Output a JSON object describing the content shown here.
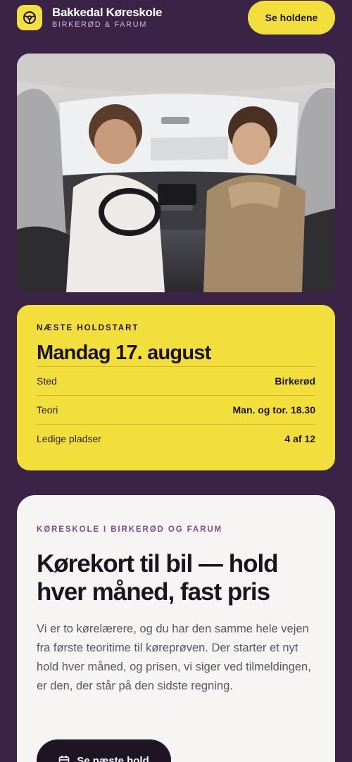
{
  "header": {
    "logo_icon": "steering-wheel-icon",
    "brand_name": "Bakkedal Køreskole",
    "brand_sub": "BIRKERØD & FARUM",
    "cta_label": "Se holdene"
  },
  "hero": {
    "image": "photo of driving instructor and student in car interior"
  },
  "next_course": {
    "eyebrow": "NÆSTE HOLDSTART",
    "date": "Mandag 17. august",
    "rows": [
      {
        "label": "Sted",
        "value": "Birkerød"
      },
      {
        "label": "Teori",
        "value": "Man. og tor. 18.30"
      },
      {
        "label": "Ledige pladser",
        "value": "4 af 12"
      }
    ]
  },
  "intro": {
    "eyebrow": "KØRESKOLE I BIRKERØD OG FARUM",
    "title": "Kørekort til bil — hold hver måned, fast pris",
    "body": "Vi er to kørelærere, og du har den samme hele vejen fra første teoritime til køreprøven. Der starter et nyt hold hver måned, og prisen, vi siger ved tilmeldingen, er den, der står på den sidste regning.",
    "cta_label": "Se næste hold",
    "cta_icon": "calendar-icon"
  },
  "colors": {
    "background": "#3a2346",
    "accent": "#f2df3b",
    "card": "#f7f5f4",
    "eyebrow": "#7d4a8f",
    "dark_button": "#1e1424"
  }
}
